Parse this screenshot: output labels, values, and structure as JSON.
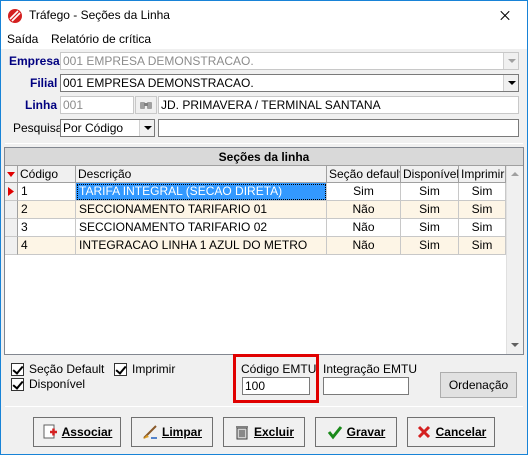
{
  "window": {
    "title": "Tráfego - Seções da Linha"
  },
  "menu": {
    "saida": "Saída",
    "relatorio": "Relatório de crítica"
  },
  "form": {
    "empresa_label": "Empresa",
    "empresa_value": "001 EMPRESA DEMONSTRACAO.",
    "filial_label": "Filial",
    "filial_value": "001 EMPRESA DEMONSTRACAO.",
    "linha_label": "Linha",
    "linha_code": "001",
    "linha_name": "JD. PRIMAVERA / TERMINAL SANTANA",
    "pesquisa_label": "Pesquisa",
    "pesquisa_value": "Por Código",
    "pesquisa_text": ""
  },
  "grid": {
    "title": "Seções da linha",
    "columns": [
      "Código",
      "Descrição",
      "Seção default",
      "Disponível",
      "Imprimir"
    ],
    "rows": [
      {
        "codigo": "1",
        "descricao": "TARIFA INTEGRAL (SECAO DIRETA)",
        "default": "Sim",
        "disponivel": "Sim",
        "imprimir": "Sim"
      },
      {
        "codigo": "2",
        "descricao": "SECCIONAMENTO TARIFARIO 01",
        "default": "Não",
        "disponivel": "Sim",
        "imprimir": "Sim"
      },
      {
        "codigo": "3",
        "descricao": "SECCIONAMENTO TARIFARIO 02",
        "default": "Não",
        "disponivel": "Sim",
        "imprimir": "Sim"
      },
      {
        "codigo": "4",
        "descricao": "INTEGRACAO LINHA 1 AZUL DO METRO",
        "default": "Não",
        "disponivel": "Sim",
        "imprimir": "Sim"
      }
    ]
  },
  "options": {
    "secao_default": "Seção Default",
    "disponivel": "Disponível",
    "imprimir": "Imprimir",
    "codigo_emtu_label": "Código EMTU",
    "codigo_emtu_value": "100",
    "integracao_emtu_label": "Integração EMTU",
    "integracao_emtu_value": "",
    "ordenacao": "Ordenação"
  },
  "buttons": {
    "associar": "Associar",
    "limpar": "Limpar",
    "excluir": "Excluir",
    "gravar": "Gravar",
    "cancelar": "Cancelar"
  },
  "colors": {
    "label_blue": "#000080",
    "selection": "#3399ff",
    "highlight": "#e00000"
  }
}
